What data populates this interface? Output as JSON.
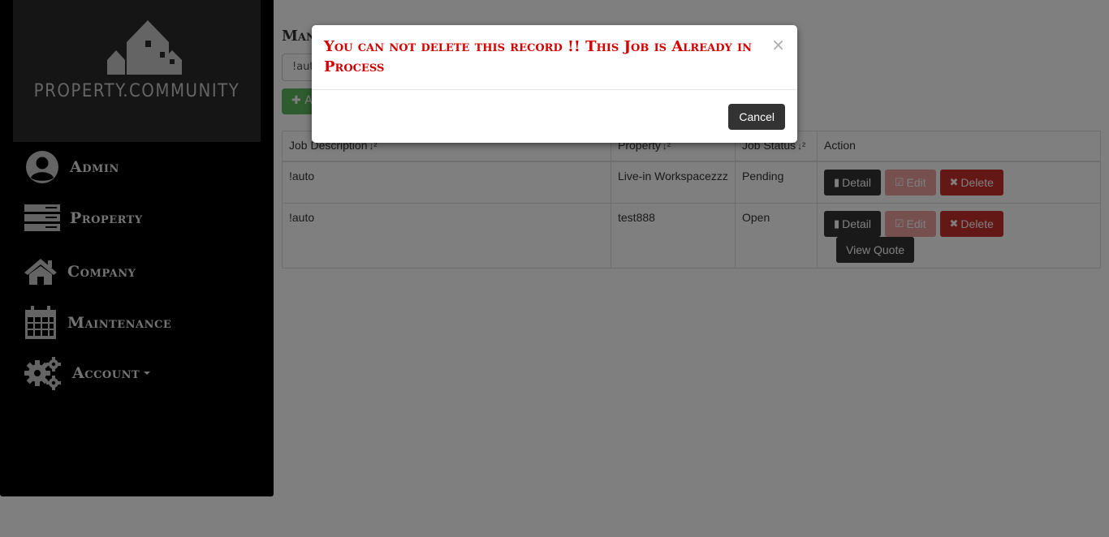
{
  "sidebar": {
    "brand": "PROPERTY.COMMUNITY",
    "items": [
      {
        "label": "Admin",
        "icon": "user-circle-icon"
      },
      {
        "label": "Property",
        "icon": "server-icon"
      },
      {
        "label": "Company",
        "icon": "home-icon"
      },
      {
        "label": "Maintenance",
        "icon": "calendar-icon"
      },
      {
        "label": "Account",
        "icon": "gears-icon"
      }
    ]
  },
  "main": {
    "title_partial": "Man",
    "search_value": "!auto",
    "add_button": "A"
  },
  "table": {
    "headers": [
      "Job Description",
      "Property",
      "Job Status",
      "Action"
    ],
    "sort_icon": "↓²",
    "rows": [
      {
        "description": "!auto",
        "property": "Live-in Workspacezzz",
        "status": "Pending"
      },
      {
        "description": "!auto",
        "property": "test888",
        "status": "Open"
      }
    ],
    "actions": {
      "detail": "Detail",
      "edit": "Edit",
      "delete": "Delete",
      "view_quote": "View Quote"
    }
  },
  "modal": {
    "title": "You can not delete this record !! This Job is Already in Process",
    "close": "×",
    "cancel": "Cancel"
  },
  "colors": {
    "sidebar_bg": "#000000",
    "brand_bg": "#2b2b2b",
    "modal_title": "#d40000",
    "button_dark": "#333333",
    "button_danger": "#c9302c",
    "button_success": "#5cb85c"
  }
}
